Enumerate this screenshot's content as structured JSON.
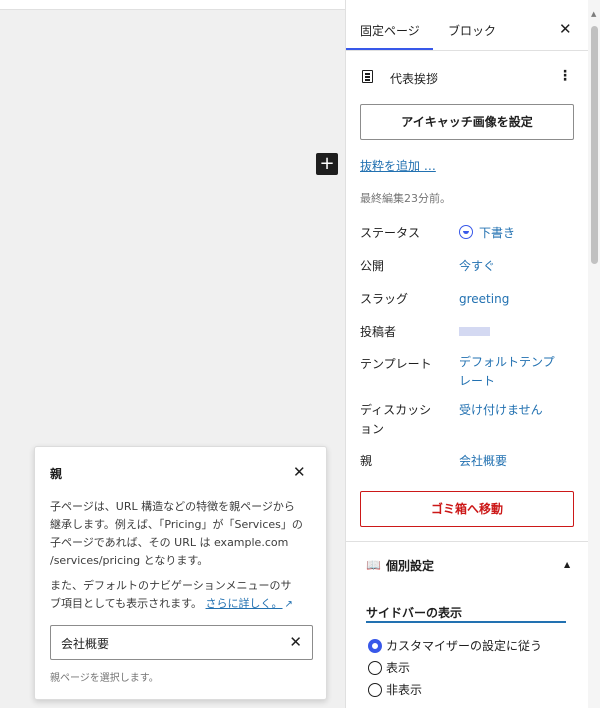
{
  "sidebar": {
    "tabs": [
      "固定ページ",
      "ブロック"
    ],
    "doc_title": "代表挨拶",
    "featured_image_button": "アイキャッチ画像を設定",
    "add_excerpt": "抜粋を追加 …",
    "last_edited": "最終編集23分前。",
    "rows": {
      "status": {
        "label": "ステータス",
        "value": "下書き"
      },
      "publish": {
        "label": "公開",
        "value": "今すぐ"
      },
      "slug": {
        "label": "スラッグ",
        "value": "greeting"
      },
      "author": {
        "label": "投稿者"
      },
      "template": {
        "label": "テンプレート",
        "value_line1": "デフォルトテンプ",
        "value_line2": "レート"
      },
      "discussion": {
        "label_line1": "ディスカッシ",
        "label_line2": "ョン",
        "value": "受け付けません"
      },
      "parent": {
        "label": "親",
        "value": "会社概要"
      }
    },
    "trash_button": "ゴミ箱へ移動",
    "custom_panel_title": "個別設定",
    "sidebar_display": {
      "title": "サイドバーの表示",
      "options": [
        "カスタマイザーの設定に従う",
        "表示",
        "非表示"
      ],
      "selected": 0
    }
  },
  "popover": {
    "title": "親",
    "p1_lines": [
      "子ページは、URL 構造などの特徴を親ページから",
      "継承します。例えば、「Pricing」が「Services」の",
      "子ページであれば、その URL は example.com",
      "/services/pricing となります。"
    ],
    "p2_lines": [
      "また、デフォルトのナビゲーションメニューのサ",
      "ブ項目としても表示されます。"
    ],
    "learn_more": "さらに詳しく。",
    "input_value": "会社概要",
    "help": "親ページを選択します。"
  },
  "icons": {
    "close": "close-icon",
    "plus": "plus-icon",
    "document": "document-icon",
    "more": "more-vertical-icon",
    "book": "book-icon",
    "external": "external-link-icon"
  },
  "colors": {
    "accent": "#3858e9",
    "link": "#2271b1",
    "danger": "#cc1818"
  }
}
